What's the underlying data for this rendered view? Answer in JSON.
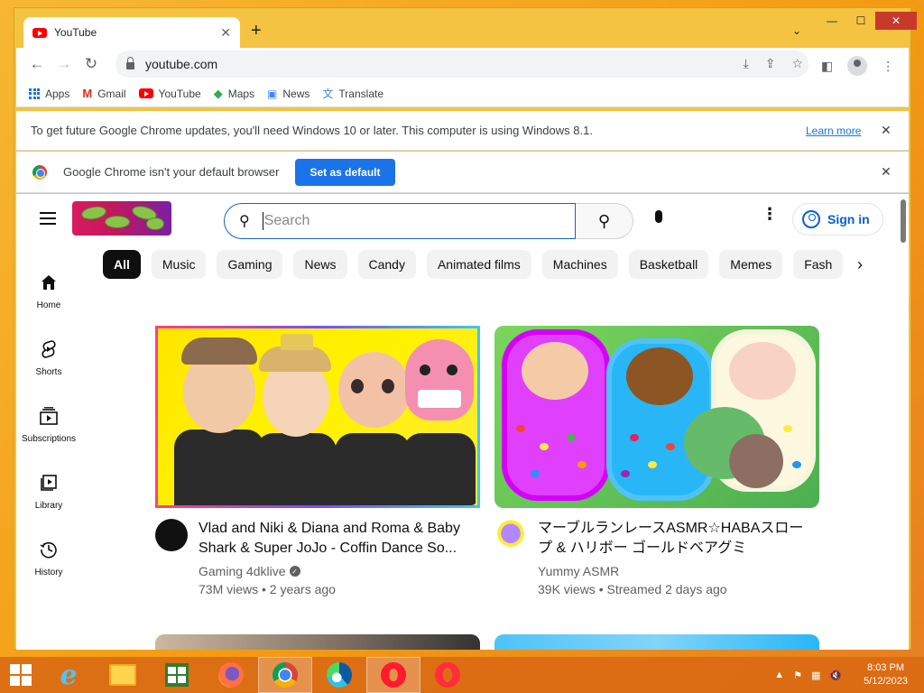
{
  "browser": {
    "tab_title": "YouTube",
    "new_tab": "+",
    "tab_search": "⌄",
    "window_controls": {
      "minimize": "—",
      "maximize": "☐",
      "close": "✕"
    },
    "url": "youtube.com",
    "bookmarks": [
      {
        "label": "Apps",
        "icon": "apps-grid-icon"
      },
      {
        "label": "Gmail",
        "icon": "gmail-icon"
      },
      {
        "label": "YouTube",
        "icon": "youtube-icon"
      },
      {
        "label": "Maps",
        "icon": "maps-icon"
      },
      {
        "label": "News",
        "icon": "news-icon"
      },
      {
        "label": "Translate",
        "icon": "translate-icon"
      }
    ],
    "update_bar": {
      "message": "To get future Google Chrome updates, you'll need Windows 10 or later. This computer is using Windows 8.1.",
      "link": "Learn more",
      "close": "✕"
    },
    "default_bar": {
      "message": "Google Chrome isn't your default browser",
      "button": "Set as default",
      "close": "✕"
    }
  },
  "youtube": {
    "search_placeholder": "Search",
    "sign_in": "Sign in",
    "chips": [
      "All",
      "Music",
      "Gaming",
      "News",
      "Candy",
      "Animated films",
      "Machines",
      "Basketball",
      "Memes",
      "Fash"
    ],
    "sidebar": [
      {
        "label": "Home",
        "icon": "home-icon"
      },
      {
        "label": "Shorts",
        "icon": "shorts-icon"
      },
      {
        "label": "Subscriptions",
        "icon": "subscriptions-icon"
      },
      {
        "label": "Library",
        "icon": "library-icon"
      },
      {
        "label": "History",
        "icon": "history-icon"
      }
    ],
    "videos": [
      {
        "title": "Vlad and Niki & Diana and Roma & Baby Shark & Super JoJo - Coffin Dance So...",
        "channel": "Gaming 4dklive",
        "verified": true,
        "meta": "73M views • 2 years ago"
      },
      {
        "title": "マーブルランレースASMR☆HABAスロープ & ハリボー ゴールドベアグミ",
        "channel": "Yummy ASMR",
        "verified": false,
        "meta": "39K views • Streamed 2 days ago"
      }
    ]
  },
  "taskbar": {
    "apps": [
      "windows-start-icon",
      "internet-explorer-icon",
      "file-explorer-icon",
      "store-icon",
      "firefox-icon",
      "chrome-icon",
      "edge-icon",
      "opera-icon",
      "opera-gx-icon"
    ],
    "time": "8:03 PM",
    "date": "5/12/2023"
  },
  "colors": {
    "desktop": "#f39c12",
    "youtube_red": "#ff0000",
    "link_blue": "#065fd4",
    "chrome_blue": "#1a73e8",
    "taskbar": "#da6a14"
  }
}
